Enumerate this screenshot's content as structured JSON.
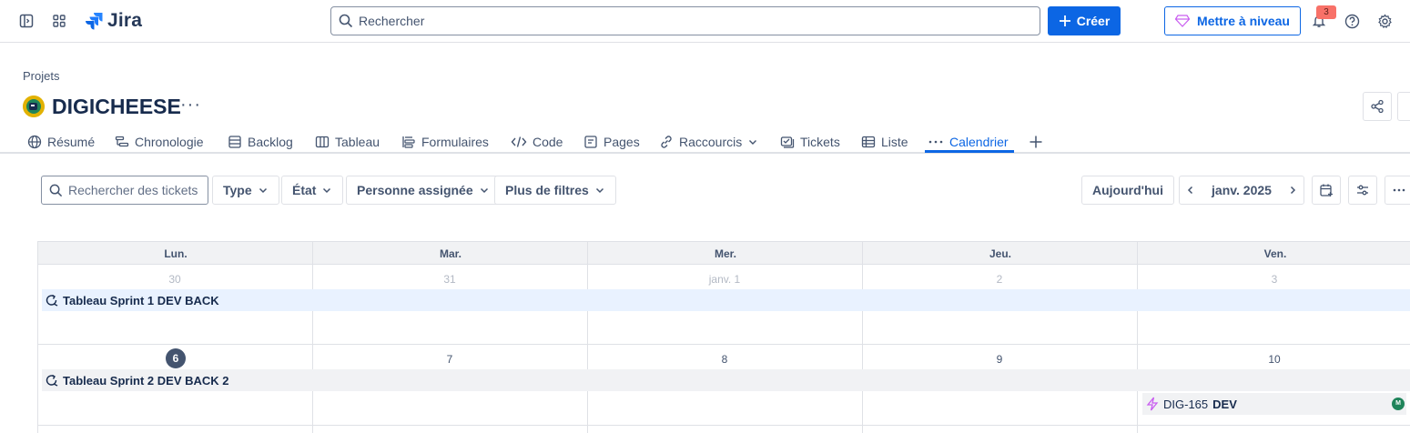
{
  "topbar": {
    "app_name": "Jira",
    "search_placeholder": "Rechercher",
    "create_label": "Créer",
    "upgrade_label": "Mettre à niveau",
    "notification_count": "3"
  },
  "project": {
    "breadcrumb": "Projets",
    "name": "DIGICHEESE",
    "more": "···"
  },
  "tabs": [
    {
      "label": "Résumé",
      "icon": "globe-icon"
    },
    {
      "label": "Chronologie",
      "icon": "timeline-icon"
    },
    {
      "label": "Backlog",
      "icon": "backlog-icon"
    },
    {
      "label": "Tableau",
      "icon": "board-icon"
    },
    {
      "label": "Formulaires",
      "icon": "forms-icon"
    },
    {
      "label": "Code",
      "icon": "code-icon"
    },
    {
      "label": "Pages",
      "icon": "pages-icon"
    },
    {
      "label": "Raccourcis",
      "icon": "link-icon"
    },
    {
      "label": "Tickets",
      "icon": "tickets-icon"
    },
    {
      "label": "Liste",
      "icon": "list-icon"
    },
    {
      "label": "Calendrier",
      "icon": "more-icon",
      "active": true
    }
  ],
  "filters": {
    "search_placeholder": "Rechercher des tickets",
    "type": "Type",
    "state": "État",
    "assignee": "Personne assignée",
    "more_filters": "Plus de filtres",
    "today": "Aujourd'hui",
    "month": "janv. 2025"
  },
  "calendar": {
    "days": [
      "Lun.",
      "Mar.",
      "Mer.",
      "Jeu.",
      "Ven."
    ],
    "week1": [
      "30",
      "31",
      "janv. 1",
      "2",
      "3"
    ],
    "week2": [
      "6",
      "7",
      "8",
      "9",
      "10"
    ],
    "sprint1": "Tableau Sprint 1 DEV BACK",
    "sprint2": "Tableau Sprint 2 DEV BACK 2",
    "ticket": {
      "key": "DIG-165",
      "summary": "DEV",
      "avatar": "M"
    }
  },
  "colors": {
    "accent": "#0c66e4",
    "sprint_active_bg": "#e9f2ff",
    "badge": "#f87168"
  }
}
